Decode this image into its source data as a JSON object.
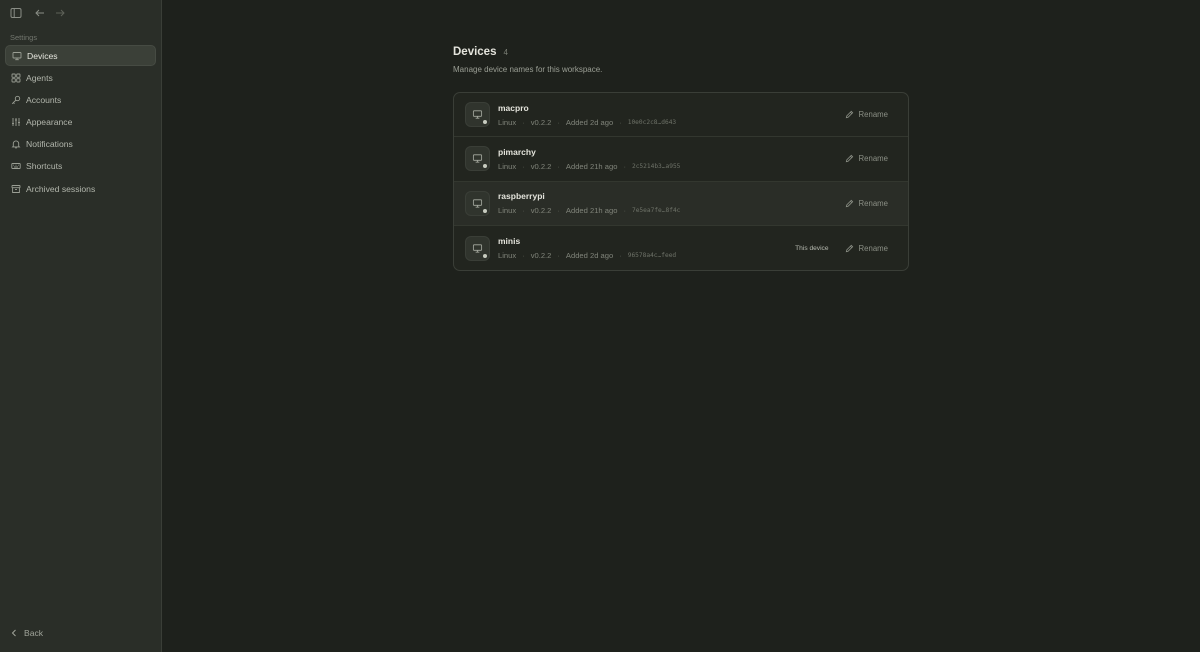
{
  "sidebar": {
    "section_label": "Settings",
    "items": [
      {
        "label": "Devices",
        "icon": "monitor-icon",
        "active": true
      },
      {
        "label": "Agents",
        "icon": "grid-icon",
        "active": false
      },
      {
        "label": "Accounts",
        "icon": "key-icon",
        "active": false
      },
      {
        "label": "Appearance",
        "icon": "sliders-icon",
        "active": false
      },
      {
        "label": "Notifications",
        "icon": "bell-icon",
        "active": false
      },
      {
        "label": "Shortcuts",
        "icon": "keyboard-icon",
        "active": false
      },
      {
        "label": "Archived sessions",
        "icon": "archive-icon",
        "active": false
      }
    ],
    "back_label": "Back"
  },
  "header": {
    "title": "Devices",
    "count": "4",
    "subtitle": "Manage device names for this workspace."
  },
  "devices": [
    {
      "name": "macpro",
      "os": "Linux",
      "version": "v0.2.2",
      "added": "Added 2d ago",
      "id": "10e0c2c8…d643",
      "this_device": "",
      "rename_label": "Rename"
    },
    {
      "name": "pimarchy",
      "os": "Linux",
      "version": "v0.2.2",
      "added": "Added 21h ago",
      "id": "2c5214b3…a955",
      "this_device": "",
      "rename_label": "Rename"
    },
    {
      "name": "raspberrypi",
      "os": "Linux",
      "version": "v0.2.2",
      "added": "Added 21h ago",
      "id": "7e5ea7fe…8f4c",
      "this_device": "",
      "rename_label": "Rename"
    },
    {
      "name": "minis",
      "os": "Linux",
      "version": "v0.2.2",
      "added": "Added 2d ago",
      "id": "96578a4c…feed",
      "this_device": "This device",
      "rename_label": "Rename"
    }
  ]
}
